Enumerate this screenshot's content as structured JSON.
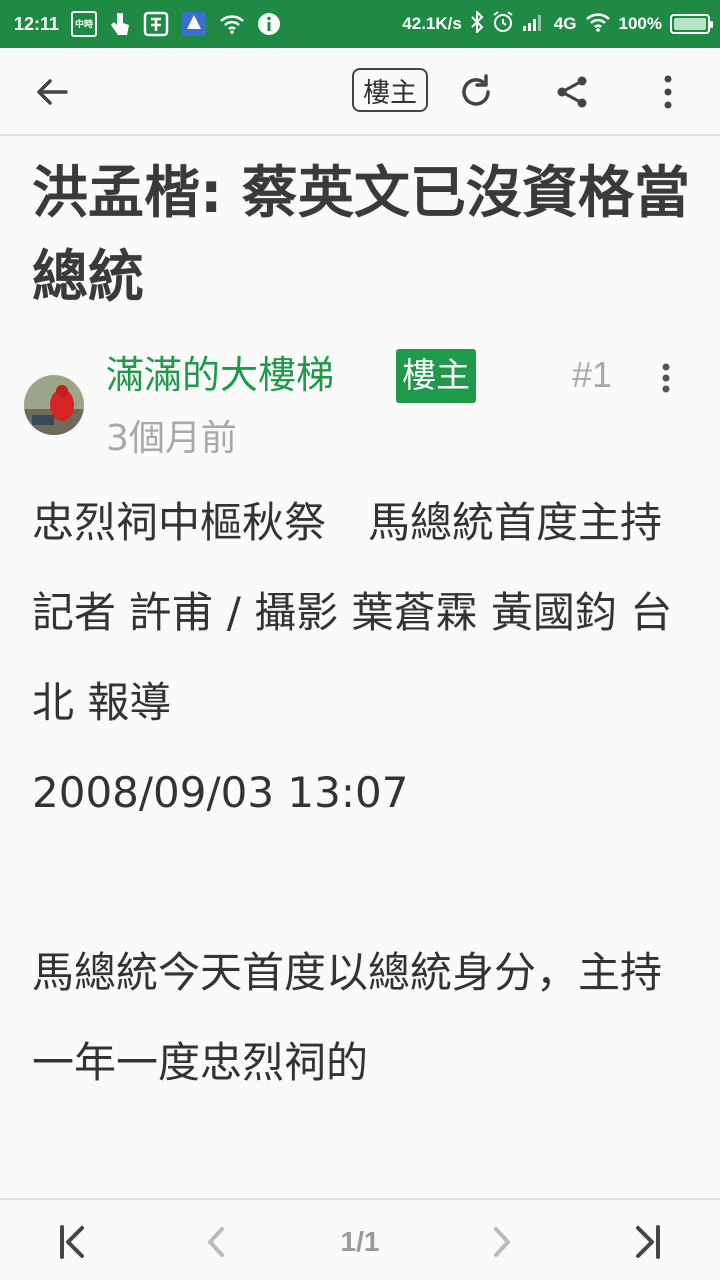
{
  "status_bar": {
    "time": "12:11",
    "app_icon_1_text": "中時",
    "net_speed": "42.1K/s",
    "network": "4G",
    "battery": "100%"
  },
  "toolbar": {
    "back_icon": "arrow-left-icon",
    "op_label": "樓主",
    "refresh_icon": "refresh-icon",
    "share_icon": "share-icon",
    "more_icon": "more-vertical-icon"
  },
  "post": {
    "title": "洪孟楷: 蔡英文已沒資格當總統",
    "author": "滿滿的大樓梯",
    "author_tag": "樓主",
    "floor": "#1",
    "time_ago": "3個月前",
    "body": [
      "忠烈祠中樞秋祭　馬總統首度主持",
      "記者 許甫 / 攝影 葉蒼霖 黃國鈞 台北 報導",
      "2008/09/03 13:07",
      "",
      "馬總統今天首度以總統身分，主持一年一度忠烈祠的"
    ]
  },
  "bottom_nav": {
    "first_icon": "first-page-icon",
    "prev_icon": "chevron-left-icon",
    "page": "1/1",
    "next_icon": "chevron-right-icon",
    "last_icon": "last-page-icon"
  },
  "colors": {
    "status_bar": "#1e8a43",
    "accent": "#1e9a4a",
    "muted": "#a8a8a8"
  }
}
